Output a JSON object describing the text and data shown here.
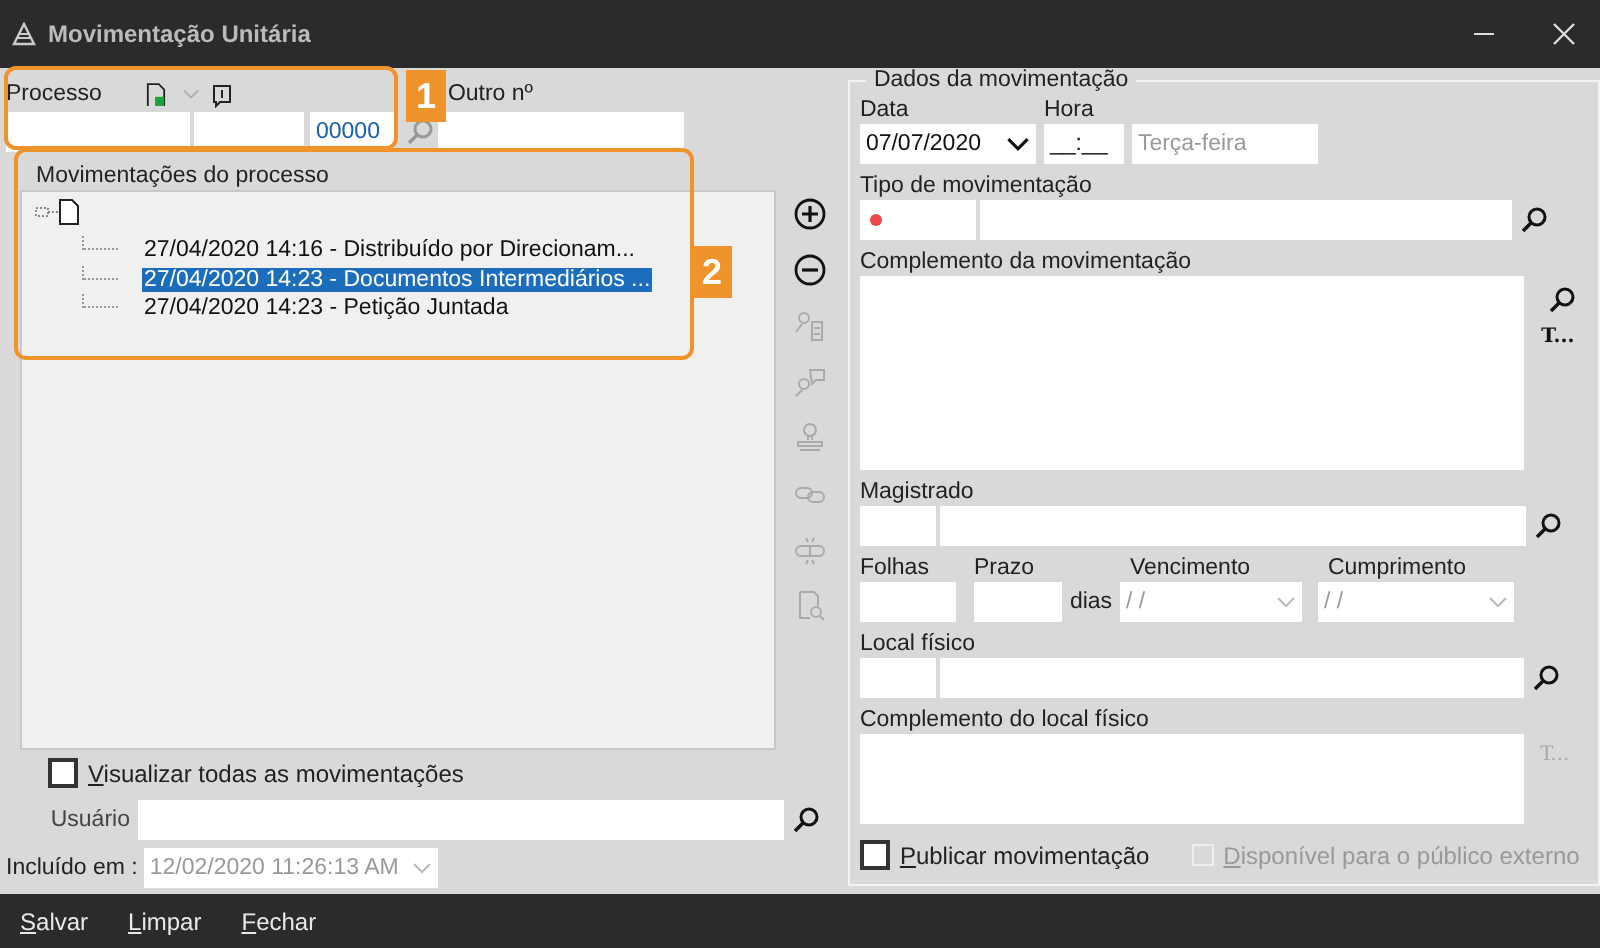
{
  "window": {
    "title": "Movimentação Unitária"
  },
  "process": {
    "label": "Processo",
    "number_suffix": "00000",
    "other_label": "Outro nº"
  },
  "movements": {
    "title": "Movimentações do processo",
    "items": [
      {
        "text": "27/04/2020 14:16 - Distribuído por Direcionam...",
        "selected": false
      },
      {
        "text": "27/04/2020 14:23 - Documentos Intermediários ...",
        "selected": true
      },
      {
        "text": "27/04/2020 14:23 - Petição Juntada",
        "selected": false
      }
    ]
  },
  "tool_buttons": [
    {
      "kind": "add",
      "disabled": false
    },
    {
      "kind": "remove",
      "disabled": false
    },
    {
      "kind": "person-document",
      "disabled": true
    },
    {
      "kind": "person-comment",
      "disabled": true
    },
    {
      "kind": "stamp",
      "disabled": true
    },
    {
      "kind": "link",
      "disabled": true
    },
    {
      "kind": "unlink",
      "disabled": true
    },
    {
      "kind": "document-search",
      "disabled": true
    }
  ],
  "view_all": {
    "label": "Visualizar todas as movimentações",
    "checked": false
  },
  "user": {
    "label": "Usuário"
  },
  "included": {
    "label": "Incluído em :",
    "value": "12/02/2020 11:26:13 AM"
  },
  "details": {
    "title": "Dados da movimentação",
    "date_label": "Data",
    "date_value": "07/07/2020",
    "time_label": "Hora",
    "time_value": "__:__",
    "weekday": "Terça-feira",
    "type_label": "Tipo de movimentação",
    "complement_label": "Complemento da movimentação",
    "complement_button": "T...",
    "judge_label": "Magistrado",
    "sheets_label": "Folhas",
    "term_label": "Prazo",
    "days_label": "dias",
    "due_label": "Vencimento",
    "due_value": " / /",
    "fulfillment_label": "Cumprimento",
    "fulfillment_value": " / /",
    "location_label": "Local físico",
    "location_complement_label": "Complemento do local físico",
    "location_complement_button": "T...",
    "publish": {
      "label": "Publicar movimentação",
      "checked": false,
      "disabled": false
    },
    "public": {
      "label": "Disponível para o público externo",
      "checked": false,
      "disabled": true
    }
  },
  "footer_buttons": [
    "Salvar",
    "Limpar",
    "Fechar"
  ],
  "callouts": [
    {
      "label": "1"
    },
    {
      "label": "2"
    }
  ]
}
